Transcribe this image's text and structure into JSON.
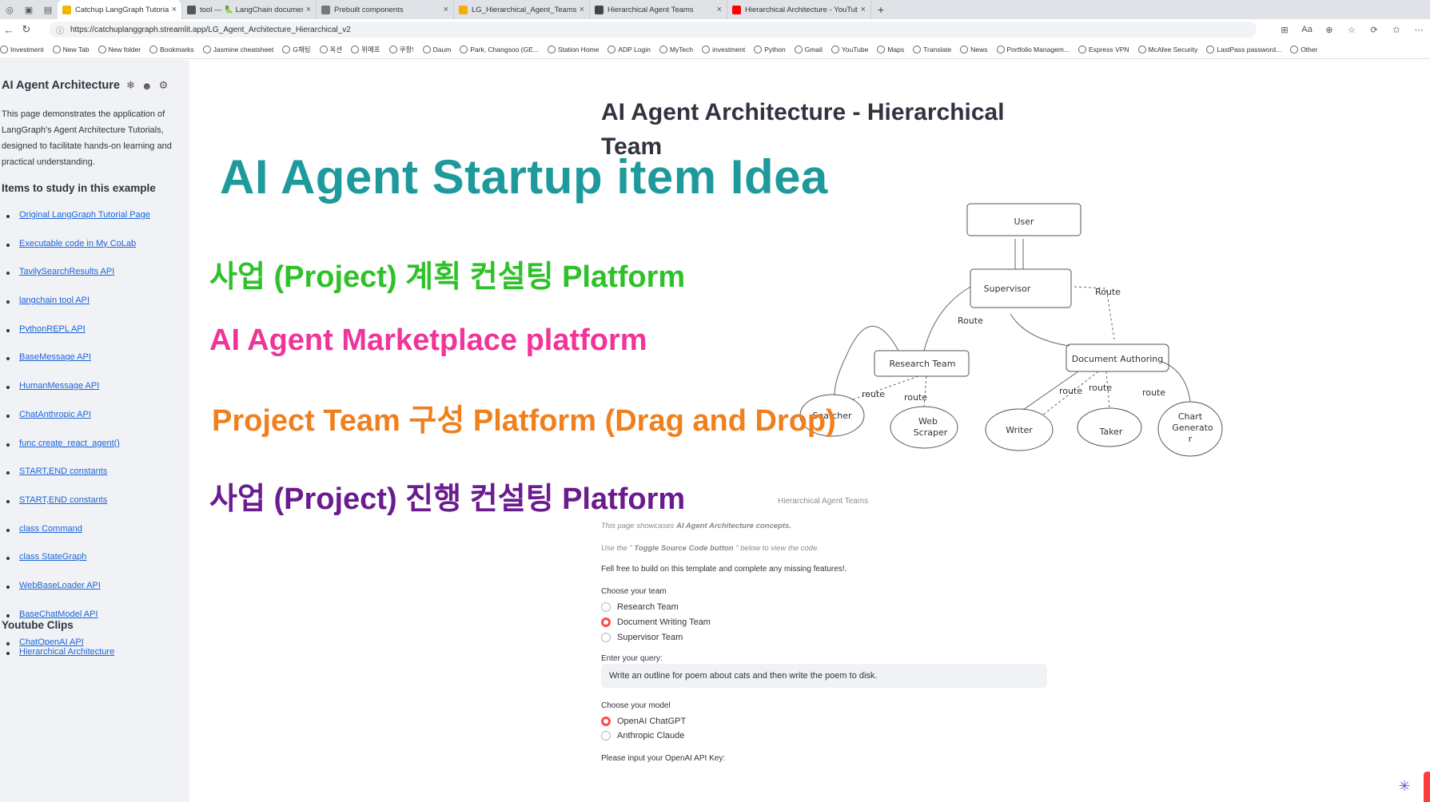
{
  "browser": {
    "tabs": [
      {
        "label": "Catchup LangGraph Tutorial - Str",
        "color": "#f4b400",
        "active": true
      },
      {
        "label": "tool — 🦜 LangChain documen",
        "color": "#555555",
        "active": false
      },
      {
        "label": "Prebuilt components",
        "color": "#777777",
        "active": false
      },
      {
        "label": "LG_Hierarchical_Agent_Teams_Ol",
        "color": "#f9ab00",
        "active": false
      },
      {
        "label": "Hierarchical Agent Teams",
        "color": "#444444",
        "active": false
      },
      {
        "label": "Hierarchical Architecture - YouTub",
        "color": "#ff0000",
        "active": false
      }
    ],
    "url": "https://catchuplanggraph.streamlit.app/LG_Agent_Architecture_Hierarchical_v2",
    "bookmarks": [
      "Investment",
      "New Tab",
      "New folder",
      "Bookmarks",
      "Jasmine cheatsheet",
      "G채팅",
      "옥션",
      "위메프",
      "쿠팡!",
      "Daum",
      "Park, Changsoo (GE...",
      "Station Home",
      "ADP Login",
      "MyTech",
      "investment",
      "Python",
      "Gmail",
      "YouTube",
      "Maps",
      "Translate",
      "News",
      "Portfolio Managem...",
      "Express VPN",
      "McAfee Security",
      "LastPass password...",
      "Other"
    ]
  },
  "sidebar": {
    "title": "AI Agent Architecture",
    "description": "This page demonstrates the application of LangGraph's Agent Architecture Tutorials, designed to facilitate hands-on learning and practical understanding.",
    "items_heading": "Items to study in this example",
    "items": [
      "Original LangGraph Tutorial Page",
      "Executable code in My CoLab",
      "TavilySearchResults API",
      "langchain tool API",
      "PythonREPL API",
      "BaseMessage API",
      "HumanMessage API",
      "ChatAnthropic API",
      "func create_react_agent()",
      "START,END constants",
      "START,END constants",
      "class Command",
      "class StateGraph",
      "WebBaseLoader API",
      "BaseChatModel API",
      "ChatOpenAI API"
    ],
    "clips_heading": "Youtube Clips",
    "clips": [
      "Hierarchical Architecture"
    ]
  },
  "main": {
    "title": "AI Agent Architecture - Hierarchical Team",
    "overlay": {
      "headline": "AI Agent Startup item Idea",
      "ideas": [
        "사업 (Project) 계획 컨설팅 Platform",
        "AI Agent Marketplace platform",
        "Project Team 구성 Platform  (Drag and Drop)",
        "사업 (Project) 진행 컨설팅 Platform"
      ]
    },
    "diagram": {
      "nodes": {
        "user": "User",
        "supervisor": "Supervisor",
        "research": "Research Team",
        "document": "Document Authoring",
        "searcher": "Searcher",
        "scraper_1": "Web",
        "scraper_2": "Scraper",
        "writer": "Writer",
        "taker": "Taker",
        "chart_1": "Chart",
        "chart_2": "Generato",
        "chart_3": "r"
      },
      "edges": {
        "route_cap": "Route",
        "route": "route"
      }
    },
    "caption": "Hierarchical Agent Teams",
    "intro_prefix": "This page showcases ",
    "intro_bold": "AI Agent Architecture concepts.",
    "toggle_prefix": "Use the \" ",
    "toggle_bold": "Toggle Source Code button",
    "toggle_suffix": " \" below to view the code.",
    "free_build": "Fell free to build on this template and complete any missing features!.",
    "team_label": "Choose your team",
    "teams": [
      {
        "label": "Research Team",
        "selected": false
      },
      {
        "label": "Document Writing Team",
        "selected": true
      },
      {
        "label": "Supervisor Team",
        "selected": false
      }
    ],
    "query_label": "Enter your query:",
    "query_value": "Write an outline for poem about cats and then write the poem to disk.",
    "model_label": "Choose your model",
    "models": [
      {
        "label": "OpenAI ChatGPT",
        "selected": true
      },
      {
        "label": "Anthropic Claude",
        "selected": false
      }
    ],
    "api_key_label": "Please input your OpenAI API Key:"
  },
  "colors": {
    "accent": "#ff4b4b",
    "link": "#1c64d8",
    "sidebar_bg": "#f0f2f6",
    "headline": "#1f9a9c"
  }
}
